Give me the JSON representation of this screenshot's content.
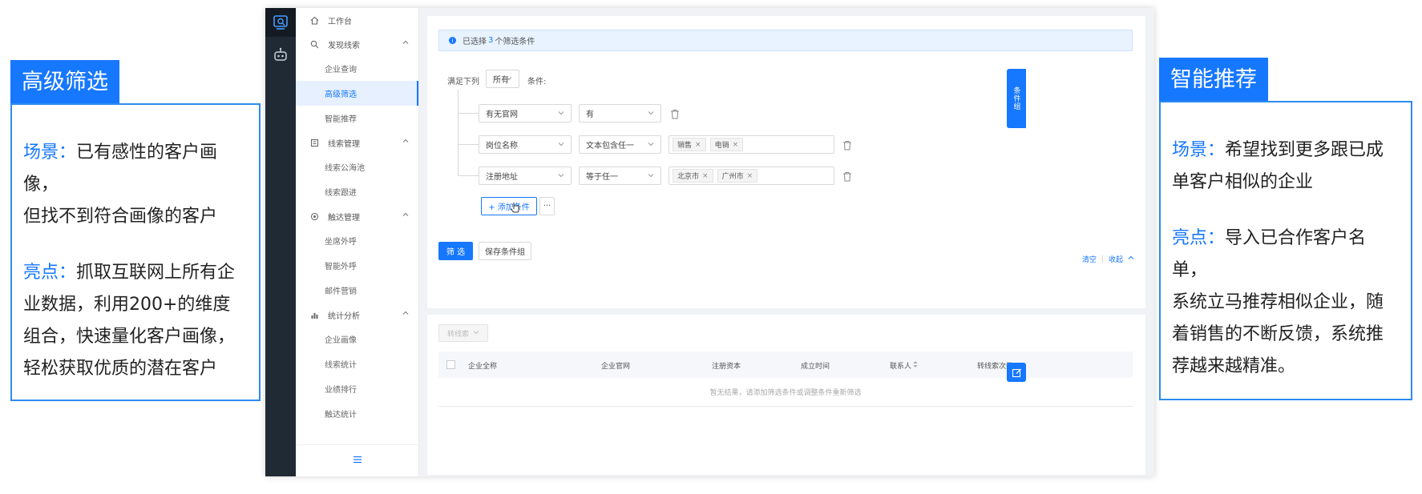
{
  "left_callout": {
    "title": "高级筛选",
    "scene_label": "场景：",
    "scene_line1": "已有感性的客户画像，",
    "scene_line2": "但找不到符合画像的客户",
    "highlight_label": "亮点：",
    "highlight_line1": "抓取互联网上所有企",
    "highlight_line2": "业数据，利用200+的维度",
    "highlight_line3": "组合，快速量化客户画像，",
    "highlight_line4": "轻松获取优质的潜在客户"
  },
  "right_callout": {
    "title": "智能推荐",
    "scene_label": "场景：",
    "scene_line1": "希望找到更多跟已成",
    "scene_line2": "单客户相似的企业",
    "highlight_label": "亮点：",
    "highlight_line1": "导入已合作客户名单，",
    "highlight_line2": "系统立马推荐相似企业，随",
    "highlight_line3": "着销售的不断反馈，系统推",
    "highlight_line4": "荐越来越精准。"
  },
  "sidebar": {
    "workbench": "工作台",
    "discover": "发现线索",
    "company_query": "企业查询",
    "advanced_filter": "高级筛选",
    "smart_recommend": "智能推荐",
    "lead_mgmt": "线索管理",
    "lead_pool": "线索公海池",
    "lead_follow": "线索跟进",
    "reach_mgmt": "触达管理",
    "seat_call": "坐席外呼",
    "smart_call": "智能外呼",
    "email_marketing": "邮件营销",
    "stats": "统计分析",
    "company_profile": "企业画像",
    "lead_stats": "线索统计",
    "performance_rank": "业绩排行",
    "reach_stats": "触达统计"
  },
  "filter": {
    "alert_prefix": "已选择",
    "alert_count": "3",
    "alert_suffix": "个筛选条件",
    "match_label": "满足下列",
    "match_value": "所有",
    "condition_label": "条件:",
    "rows": [
      {
        "field": "有无官网",
        "operator": "有",
        "values": []
      },
      {
        "field": "岗位名称",
        "operator": "文本包含任一",
        "values": [
          "销售",
          "电销"
        ]
      },
      {
        "field": "注册地址",
        "operator": "等于任一",
        "values": [
          "北京市",
          "广州市"
        ]
      }
    ],
    "add_condition": "+ 添加条件",
    "more": "···",
    "filter_button": "筛 选",
    "save_group_button": "保存条件组",
    "clear_link": "清空",
    "collapse_link": "收起"
  },
  "float_tab": "条件组",
  "results": {
    "transfer_button": "转线索",
    "columns": [
      "企业全称",
      "企业官网",
      "注册资本",
      "成立时间",
      "联系人",
      "转线索次数"
    ],
    "empty_text": "暂无结果，请添加筛选条件或调整条件重新筛选"
  }
}
